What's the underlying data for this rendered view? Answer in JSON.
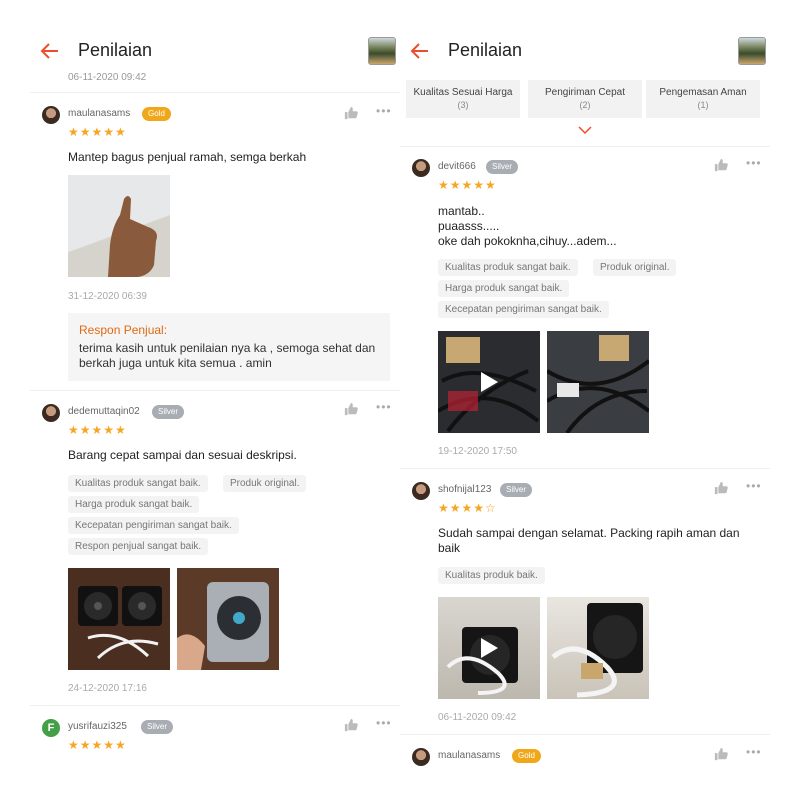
{
  "header": {
    "title": "Penilaian"
  },
  "left": {
    "clip_time": "06-11-2020 09:42",
    "reviews": [
      {
        "user": "maulanasams",
        "badge": "Gold",
        "rating": "★★★★★",
        "text": "Mantep bagus penjual ramah, semga berkah",
        "date": "31-12-2020 06:39",
        "seller_title": "Respon Penjual:",
        "seller_text": "terima kasih untuk penilaian nya ka , semoga sehat dan berkah juga untuk kita semua . amin"
      },
      {
        "user": "dedemuttaqin02",
        "badge": "Silver",
        "rating": "★★★★★",
        "text": "Barang cepat sampai dan sesuai deskripsi.",
        "tags": [
          "Kualitas produk sangat baik.",
          "Produk original.",
          "Harga produk sangat baik.",
          "Kecepatan pengiriman sangat baik.",
          "Respon penjual sangat baik."
        ],
        "date": "24-12-2020 17:16"
      },
      {
        "user": "yusrifauzi325",
        "badge": "Silver",
        "rating": "★★★★★",
        "avatar_letter": "F"
      }
    ]
  },
  "right": {
    "filters": [
      {
        "label": "Kualitas Sesuai Harga",
        "count": "(3)"
      },
      {
        "label": "Pengiriman Cepat",
        "count": "(2)"
      },
      {
        "label": "Pengemasan Aman",
        "count": "(1)"
      }
    ],
    "reviews": [
      {
        "user": "devit666",
        "badge": "Silver",
        "rating": "★★★★★",
        "lines": [
          "mantab..",
          "puaasss.....",
          "oke dah pokoknha,cihuy...adem..."
        ],
        "tags": [
          "Kualitas produk sangat baik.",
          "Produk original.",
          "Harga produk sangat baik.",
          "Kecepatan pengiriman sangat baik."
        ],
        "date": "19-12-2020 17:50"
      },
      {
        "user": "shofnijal123",
        "badge": "Silver",
        "rating": "★★★★☆",
        "text": "Sudah sampai dengan selamat. Packing rapih aman dan baik",
        "tags": [
          "Kualitas produk baik."
        ],
        "date": "06-11-2020 09:42"
      },
      {
        "user": "maulanasams",
        "badge": "Gold"
      }
    ]
  },
  "colors": {
    "accent": "#ee4d2d",
    "gold": "#f0a81a",
    "silver": "#a8acb3",
    "star": "#f5a623",
    "seller_title": "#e06a12"
  },
  "icons": {
    "back": "arrow-left-icon",
    "like": "thumbs-up-icon",
    "more": "more-dots-icon",
    "play": "play-icon",
    "chevron": "chevron-down-icon"
  }
}
